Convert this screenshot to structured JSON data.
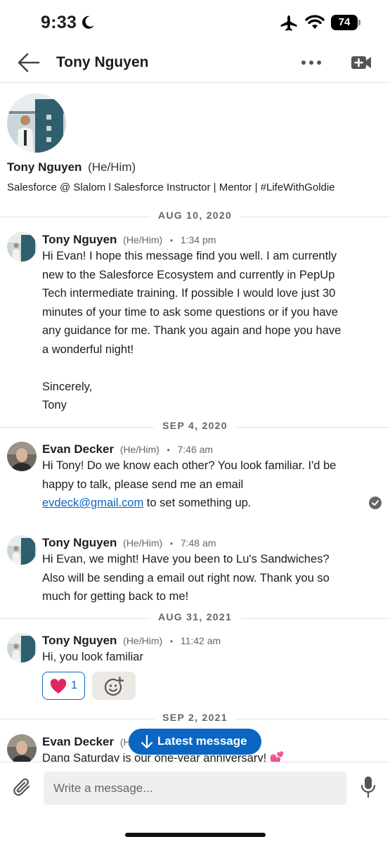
{
  "status_bar": {
    "time": "9:33",
    "battery": "74"
  },
  "header": {
    "contact_name": "Tony Nguyen"
  },
  "profile": {
    "name": "Tony Nguyen",
    "pronouns": "(He/Him)",
    "headline": "Salesforce @ Slalom l Salesforce Instructor | Mentor | #LifeWithGoldie"
  },
  "date_separators": [
    "AUG 10, 2020",
    "SEP 4, 2020",
    "AUG 31, 2021",
    "SEP 2, 2021"
  ],
  "messages": [
    {
      "sender": "Tony Nguyen",
      "pronouns": "(He/Him)",
      "time": "1:34 pm",
      "lines": [
        "Hi Evan! I hope this message find you well. I am currently",
        "new to the Salesforce Ecosystem and currently in PepUp",
        "Tech intermediate training. If possible I would love just 30",
        "minutes of your time to ask some questions or if you have",
        "any guidance for me. Thank you again and hope you have",
        "a wonderful night!",
        "Sincerely,",
        "Tony"
      ]
    },
    {
      "sender": "Evan Decker",
      "pronouns": "(He/Him)",
      "time": "7:46 am",
      "lines": [
        "Hi Tony! Do we know each other? You look familiar. I'd be",
        "happy to talk, please send me an email"
      ],
      "link": "evdeck@gmail.com",
      "after_link": " to set something up."
    },
    {
      "sender": "Tony Nguyen",
      "pronouns": "(He/Him)",
      "time": "7:48 am",
      "lines": [
        "Hi Evan, we might! Have you been to Lu's Sandwiches?",
        "Also will be sending a email out right now. Thank you so",
        "much for getting back to me!"
      ]
    },
    {
      "sender": "Tony Nguyen",
      "pronouns": "(He/Him)",
      "time": "11:42 am",
      "lines": [
        "Hi, you look familiar"
      ],
      "reaction_count": "1"
    },
    {
      "sender": "Evan Decker",
      "pronouns": "(He/Him)",
      "lines": [
        "Dang Saturday is our one-year anniversary! 💕"
      ]
    }
  ],
  "latest_message_button": "Latest message",
  "composer": {
    "placeholder": "Write a message..."
  },
  "colors": {
    "accent": "#0a66c2",
    "reaction_bg": "#ece9e4",
    "separator": "#e3e3e3"
  }
}
